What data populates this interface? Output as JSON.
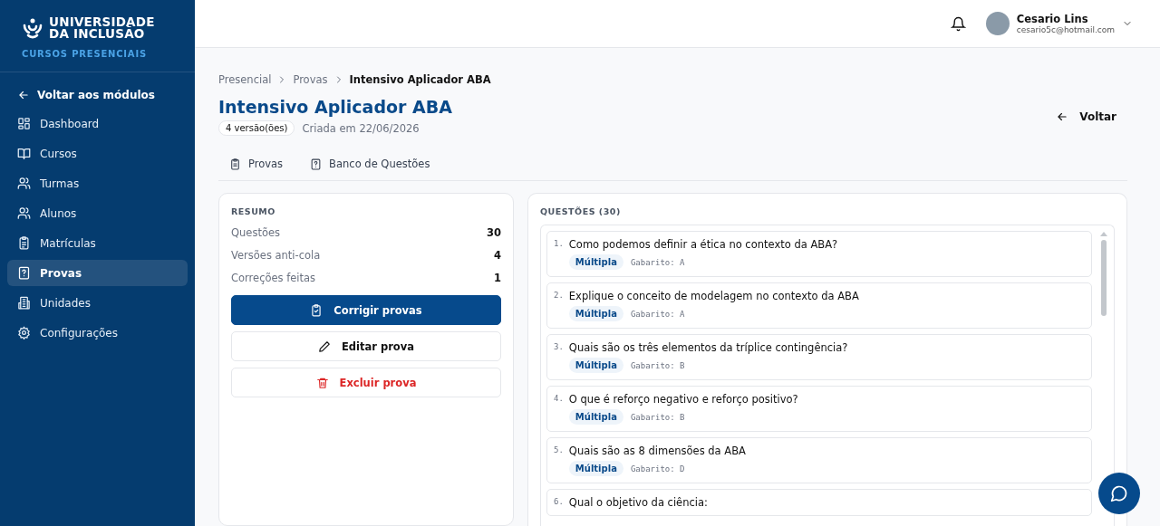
{
  "sidebar": {
    "logo_line1": "UNIVERSIDADE",
    "logo_line2": "DA INCLUSÃO",
    "subtitle": "CURSOS PRESENCIAIS",
    "back_link": "Voltar aos módulos",
    "items": [
      {
        "label": "Dashboard",
        "selected": false
      },
      {
        "label": "Cursos",
        "selected": false
      },
      {
        "label": "Turmas",
        "selected": false
      },
      {
        "label": "Alunos",
        "selected": false
      },
      {
        "label": "Matrículas",
        "selected": false
      },
      {
        "label": "Provas",
        "selected": true
      },
      {
        "label": "Unidades",
        "selected": false
      },
      {
        "label": "Configurações",
        "selected": false
      }
    ]
  },
  "header": {
    "user_name": "Cesario Lins",
    "user_email": "cesario5c@hotmail.com"
  },
  "breadcrumb": [
    "Presencial",
    "Provas",
    "Intensivo Aplicador ABA"
  ],
  "title": "Intensivo Aplicador ABA",
  "versions_badge": "4 versão(ões)",
  "created": "Criada em 22/06/2026",
  "back_button": "Voltar",
  "tabs": [
    {
      "label": "Provas"
    },
    {
      "label": "Banco de Questões"
    }
  ],
  "summary": {
    "heading": "RESUMO",
    "stats": [
      {
        "label": "Questões",
        "value": "30"
      },
      {
        "label": "Versões anti-cola",
        "value": "4"
      },
      {
        "label": "Correções feitas",
        "value": "1"
      }
    ],
    "buttons": [
      {
        "label": "Corrigir provas",
        "kind": "primary"
      },
      {
        "label": "Editar prova",
        "kind": "secondary"
      },
      {
        "label": "Excluir prova",
        "kind": "danger"
      }
    ]
  },
  "questions": {
    "heading": "QUESTÕES (30)",
    "items": [
      {
        "number": "1.",
        "text": "Como podemos definir a ética no contexto da ABA?",
        "type": "Múltipla",
        "answer": "Gabarito: A"
      },
      {
        "number": "2.",
        "text": "Explique o conceito de modelagem no contexto da ABA",
        "type": "Múltipla",
        "answer": "Gabarito: A"
      },
      {
        "number": "3.",
        "text": "Quais são os três elementos da tríplice contingência?",
        "type": "Múltipla",
        "answer": "Gabarito: B"
      },
      {
        "number": "4.",
        "text": "O que é reforço negativo e reforço positivo?",
        "type": "Múltipla",
        "answer": "Gabarito: B"
      },
      {
        "number": "5.",
        "text": "Quais são as 8 dimensões da ABA",
        "type": "Múltipla",
        "answer": "Gabarito: D"
      },
      {
        "number": "6.",
        "text": "Qual o objetivo da ciência:"
      }
    ]
  }
}
